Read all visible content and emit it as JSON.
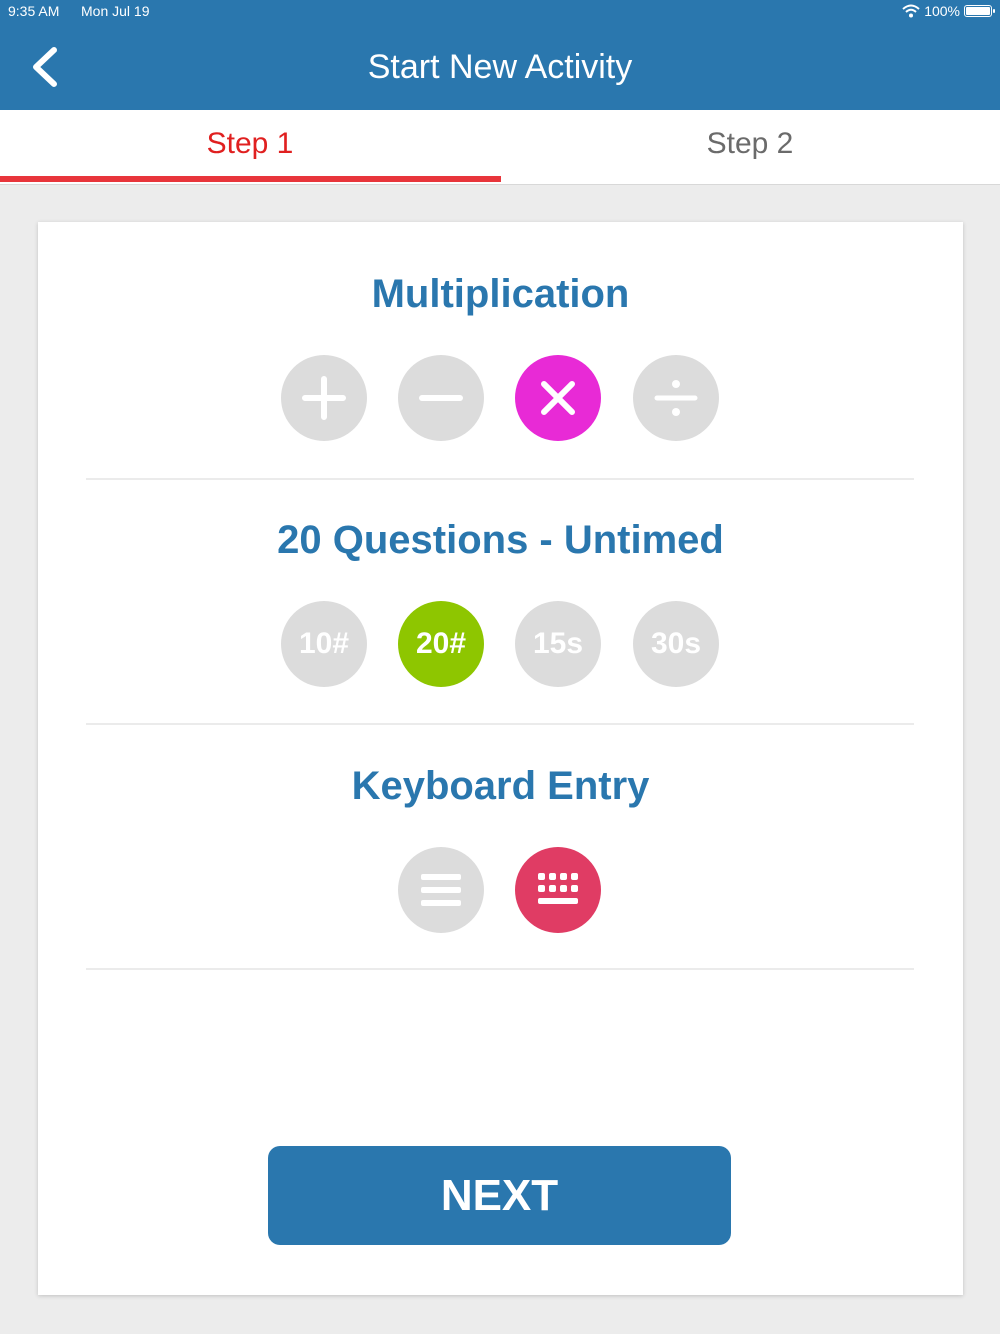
{
  "status_bar": {
    "time": "9:35 AM",
    "date": "Mon Jul 19",
    "battery": "100%",
    "wifi_icon": "wifi-icon",
    "battery_icon": "battery-icon"
  },
  "header": {
    "title": "Start New Activity",
    "back_icon": "chevron-left-icon",
    "color": "#2a77ae"
  },
  "tabs": [
    {
      "label": "Step 1",
      "active": true
    },
    {
      "label": "Step 2",
      "active": false
    }
  ],
  "operation": {
    "title": "Multiplication",
    "options": [
      {
        "icon": "plus-icon",
        "selected": false
      },
      {
        "icon": "minus-icon",
        "selected": false
      },
      {
        "icon": "multiply-icon",
        "selected": true,
        "color": "#e82ad6"
      },
      {
        "icon": "divide-icon",
        "selected": false
      }
    ]
  },
  "questions": {
    "title": "20 Questions - Untimed",
    "options": [
      {
        "label": "10#",
        "selected": false
      },
      {
        "label": "20#",
        "selected": true,
        "color": "#8ec600"
      },
      {
        "label": "15s",
        "selected": false
      },
      {
        "label": "30s",
        "selected": false
      }
    ]
  },
  "entry": {
    "title": "Keyboard Entry",
    "options": [
      {
        "icon": "list-icon",
        "selected": false
      },
      {
        "icon": "keyboard-icon",
        "selected": true,
        "color": "#e03c64"
      }
    ]
  },
  "next_label": "NEXT",
  "colors": {
    "primary": "#2a77ae",
    "active_tab": "#e02020",
    "unselected_circle": "#dcdcdc"
  }
}
